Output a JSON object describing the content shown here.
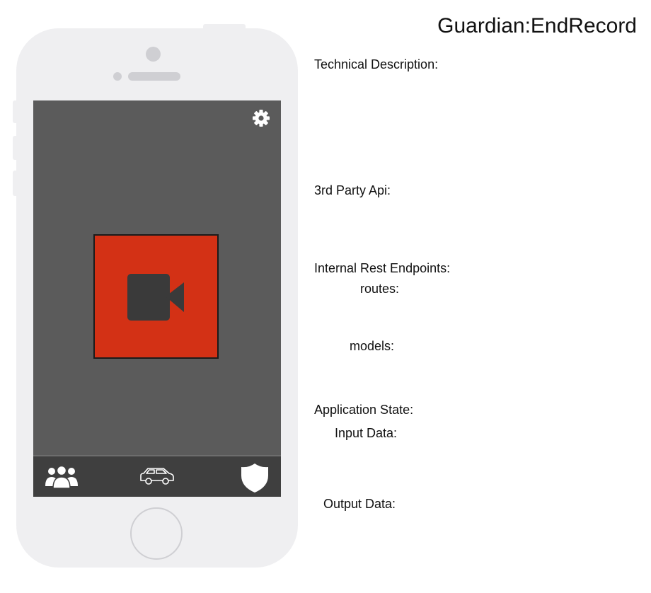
{
  "spec": {
    "title": "Guardian:EndRecord",
    "technical_description_label": "Technical Description:",
    "third_party_api_label": "3rd Party Api:",
    "internal_rest_endpoints_label": "Internal Rest Endpoints:",
    "routes_label": "routes:",
    "models_label": "models:",
    "application_state_label": "Application State:",
    "input_data_label": "Input Data:",
    "output_data_label": "Output Data:"
  },
  "app": {
    "icons": {
      "settings": "gear-icon",
      "record": "video-camera-icon",
      "tab_people": "people-icon",
      "tab_car": "car-icon",
      "tab_shield": "shield-icon"
    },
    "colors": {
      "screen_background": "#5b5b5b",
      "record_button": "#d33115",
      "tab_bar": "#3f3f3f",
      "phone_frame": "#efeff1"
    }
  }
}
